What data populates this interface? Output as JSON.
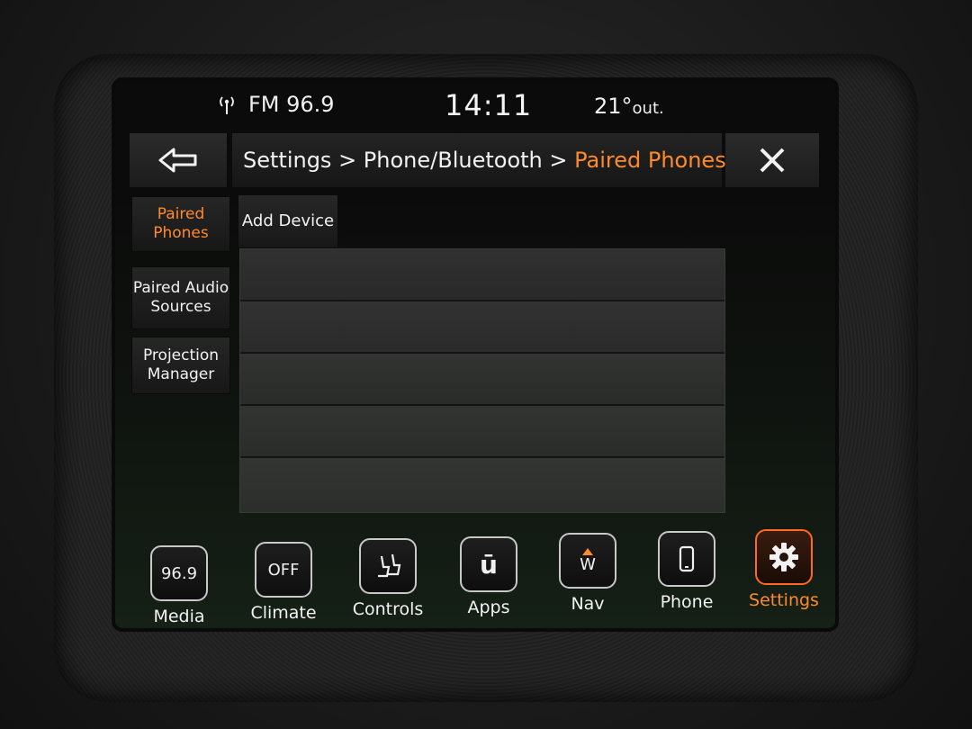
{
  "status_bar": {
    "radio": "FM 96.9",
    "time": "14:11",
    "temperature": "21°",
    "temperature_suffix": "out."
  },
  "header": {
    "breadcrumb_path": "Settings > Phone/Bluetooth > ",
    "breadcrumb_current": "Paired Phones"
  },
  "side_tabs": {
    "paired_phones": "Paired Phones",
    "paired_audio_sources": "Paired Audio Sources",
    "projection_manager": "Projection Manager"
  },
  "add_device_label": "Add Device",
  "nav": {
    "media_label": "Media",
    "media_icon_text": "96.9",
    "climate_label": "Climate",
    "climate_icon_text": "OFF",
    "controls_label": "Controls",
    "apps_label": "Apps",
    "apps_icon_text": "ū",
    "nav_label": "Nav",
    "nav_icon_text": "W",
    "phone_label": "Phone",
    "settings_label": "Settings"
  },
  "colors": {
    "accent": "#ff8a2a",
    "active_border": "#ff6a20"
  }
}
